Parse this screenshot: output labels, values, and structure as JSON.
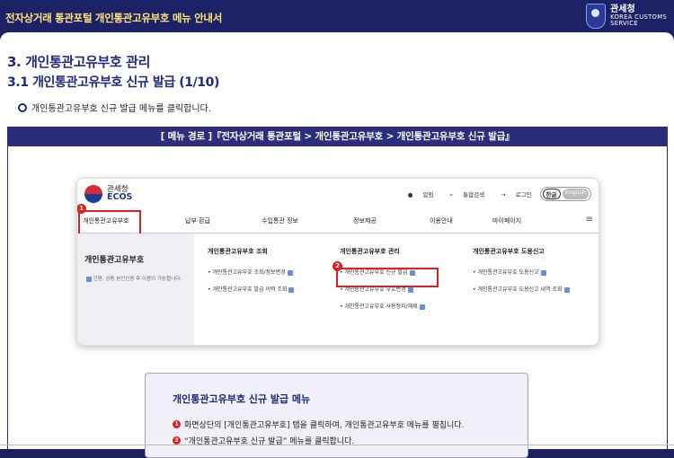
{
  "header": {
    "title": "전자상거래 통관포털 개인통관고유부호 메뉴 안내서",
    "logo_kr": "관세청",
    "logo_en1": "KOREA CUSTOMS",
    "logo_en2": "SERVICE"
  },
  "section": {
    "h1": "3. 개인통관고유부호 관리",
    "h2": "3.1 개인통관고유부호 신규 발급 (1/10)",
    "instruction": "개인통관고유부호 신규 발급 메뉴를 클릭합니다."
  },
  "menu_path": "[ 메뉴 경로 ]『전자상거래 통관포털 > 개인통관고유부호 > 개인통관고유부호 신규 발급』",
  "screenshot": {
    "brand_kr": "관세청",
    "brand_en": "ECOS",
    "util": {
      "alarm": "알림",
      "search": "통합검색",
      "login": "로그인",
      "lang_ko": "한글",
      "lang_en": "English"
    },
    "gnb": [
      "개인통관고유부호",
      "납부·환급",
      "수입통관 정보",
      "정보제공",
      "이용안내",
      "마이페이지"
    ],
    "side_title": "개인통관고유부호",
    "side_desc": "간편, 공동 본인인증 후 이용이 가능합니다.",
    "cols": [
      {
        "title": "개인통관고유부호 조회",
        "items": [
          "개인통관고유부호 조회/정보변경",
          "개인통관고유부호 발급 이력 조회"
        ]
      },
      {
        "title": "개인통관고유부호 관리",
        "items": [
          "개인통관고유부호 신규 발급",
          "개인통관고유부호 부호변경",
          "개인통관고유부호 사용정지/해제"
        ]
      },
      {
        "title": "개인통관고유부호 도용신고",
        "items": [
          "개인통관고유부호 도용신고",
          "개인통관고유부호 도용신고 내역 조회"
        ]
      }
    ],
    "badge1": "1",
    "badge2": "2"
  },
  "info": {
    "title": "개인통관고유부호 신규 발급 메뉴",
    "n1": "1",
    "step1": "화면상단의 [개인통관고유부호] 탭을 클릭하여, 개인통관고유부호 메뉴를 펼칩니다.",
    "n2": "2",
    "step2": "“개인통관고유부호 신규 발급” 메뉴를 클릭합니다."
  },
  "colors": {
    "navy": "#1d2266",
    "title_yellow": "#ffe27a",
    "highlight_red": "#e02020",
    "info_bg": "#f1eff8"
  }
}
